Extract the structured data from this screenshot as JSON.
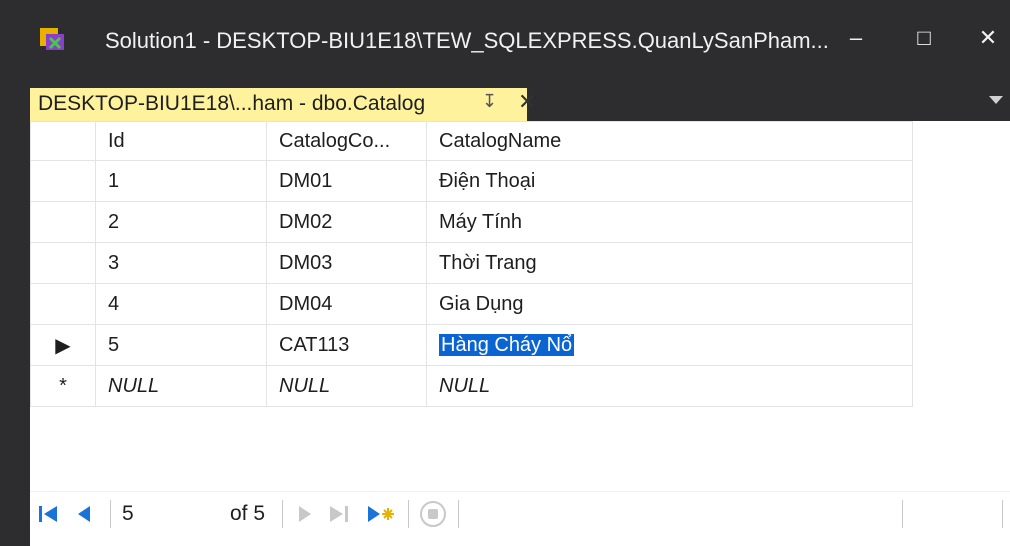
{
  "window": {
    "title": "Solution1 - DESKTOP-BIU1E18\\TEW_SQLEXPRESS.QuanLySanPham...",
    "minimize_icon": "minimize-icon",
    "maximize_icon": "maximize-icon",
    "close_icon": "close-icon",
    "minimize_glyph": "–",
    "maximize_glyph": "□",
    "close_glyph": "✕"
  },
  "tab": {
    "label": "DESKTOP-BIU1E18\\...ham - dbo.Catalog",
    "pin_glyph": "↧",
    "close_glyph": "✕",
    "color": "#fff29d"
  },
  "grid": {
    "columns": [
      "Id",
      "CatalogCo...",
      "CatalogName"
    ],
    "rows": [
      {
        "indicator": "",
        "id": "1",
        "code": "DM01",
        "name": "Điện Thoại"
      },
      {
        "indicator": "",
        "id": "2",
        "code": "DM02",
        "name": "Máy Tính"
      },
      {
        "indicator": "",
        "id": "3",
        "code": "DM03",
        "name": "Thời Trang"
      },
      {
        "indicator": "",
        "id": "4",
        "code": "DM04",
        "name": "Gia Dụng"
      },
      {
        "indicator": "▶",
        "id": "5",
        "code": "CAT113",
        "name": "Hàng Cháy Nổ"
      },
      {
        "indicator": "*",
        "id": "NULL",
        "code": "NULL",
        "name": "NULL"
      }
    ],
    "selection_color": "#0a64d2"
  },
  "navigator": {
    "position": "5",
    "of_label": "of 5"
  }
}
